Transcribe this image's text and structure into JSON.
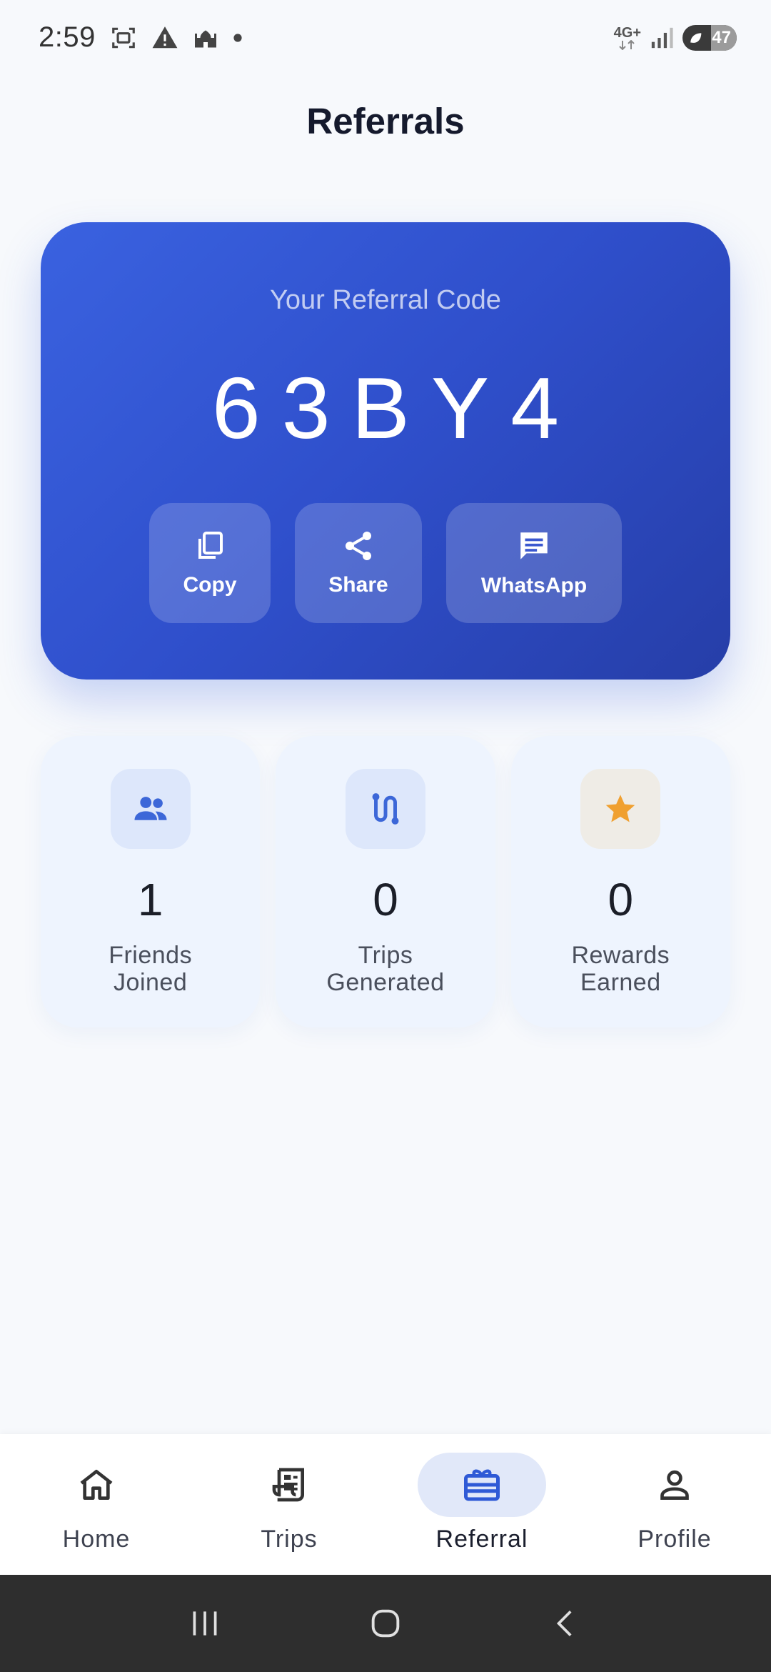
{
  "status_bar": {
    "time": "2:59",
    "network": "4G+",
    "battery": "47"
  },
  "header": {
    "title": "Referrals"
  },
  "referral": {
    "label": "Your Referral Code",
    "code": "63BY4",
    "actions": [
      {
        "label": "Copy",
        "icon": "copy-icon"
      },
      {
        "label": "Share",
        "icon": "share-icon"
      },
      {
        "label": "WhatsApp",
        "icon": "message-icon"
      }
    ]
  },
  "stats": [
    {
      "value": "1",
      "label": "Friends Joined",
      "icon": "people-icon"
    },
    {
      "value": "0",
      "label": "Trips Generated",
      "icon": "route-icon"
    },
    {
      "value": "0",
      "label": "Rewards Earned",
      "icon": "star-icon"
    }
  ],
  "bottom_nav": {
    "items": [
      {
        "label": "Home",
        "icon": "home-icon"
      },
      {
        "label": "Trips",
        "icon": "receipt-icon"
      },
      {
        "label": "Referral",
        "icon": "gift-card-icon",
        "active": true
      },
      {
        "label": "Profile",
        "icon": "person-icon"
      }
    ]
  },
  "colors": {
    "accent": "#2f4fcb",
    "card_bg": "#eef4fe",
    "star": "#f0a030"
  }
}
